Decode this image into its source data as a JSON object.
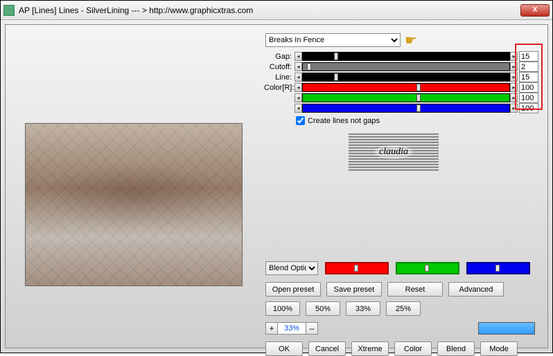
{
  "window": {
    "title": "AP [Lines]  Lines - SilverLining   --- >  http://www.graphicxtras.com",
    "close": "X"
  },
  "preset": {
    "selected": "Breaks In Fence"
  },
  "sliders": {
    "gap": {
      "label": "Gap:",
      "value": "15",
      "pct": 15
    },
    "cutoff": {
      "label": "Cutoff:",
      "value": "2",
      "pct": 2
    },
    "line": {
      "label": "Line:",
      "value": "15",
      "pct": 15
    },
    "colorR": {
      "label": "Color[R]:",
      "value": "100",
      "pct": 55
    },
    "colorG": {
      "label": "",
      "value": "100",
      "pct": 55
    },
    "colorB": {
      "label": "",
      "value": "100",
      "pct": 55
    }
  },
  "checkbox": {
    "create_lines": "Create lines not gaps",
    "checked": true
  },
  "logo": {
    "text": "claudia"
  },
  "blend": {
    "label": "Blend Options"
  },
  "buttons": {
    "open_preset": "Open preset",
    "save_preset": "Save preset",
    "reset": "Reset",
    "advanced": "Advanced",
    "p100": "100%",
    "p50": "50%",
    "p33": "33%",
    "p25": "25%",
    "ok": "OK",
    "cancel": "Cancel",
    "xtreme": "Xtreme",
    "color": "Color",
    "blend": "Blend",
    "mode": "Mode"
  },
  "zoom": {
    "plus": "+",
    "minus": "–",
    "value": "33%"
  }
}
